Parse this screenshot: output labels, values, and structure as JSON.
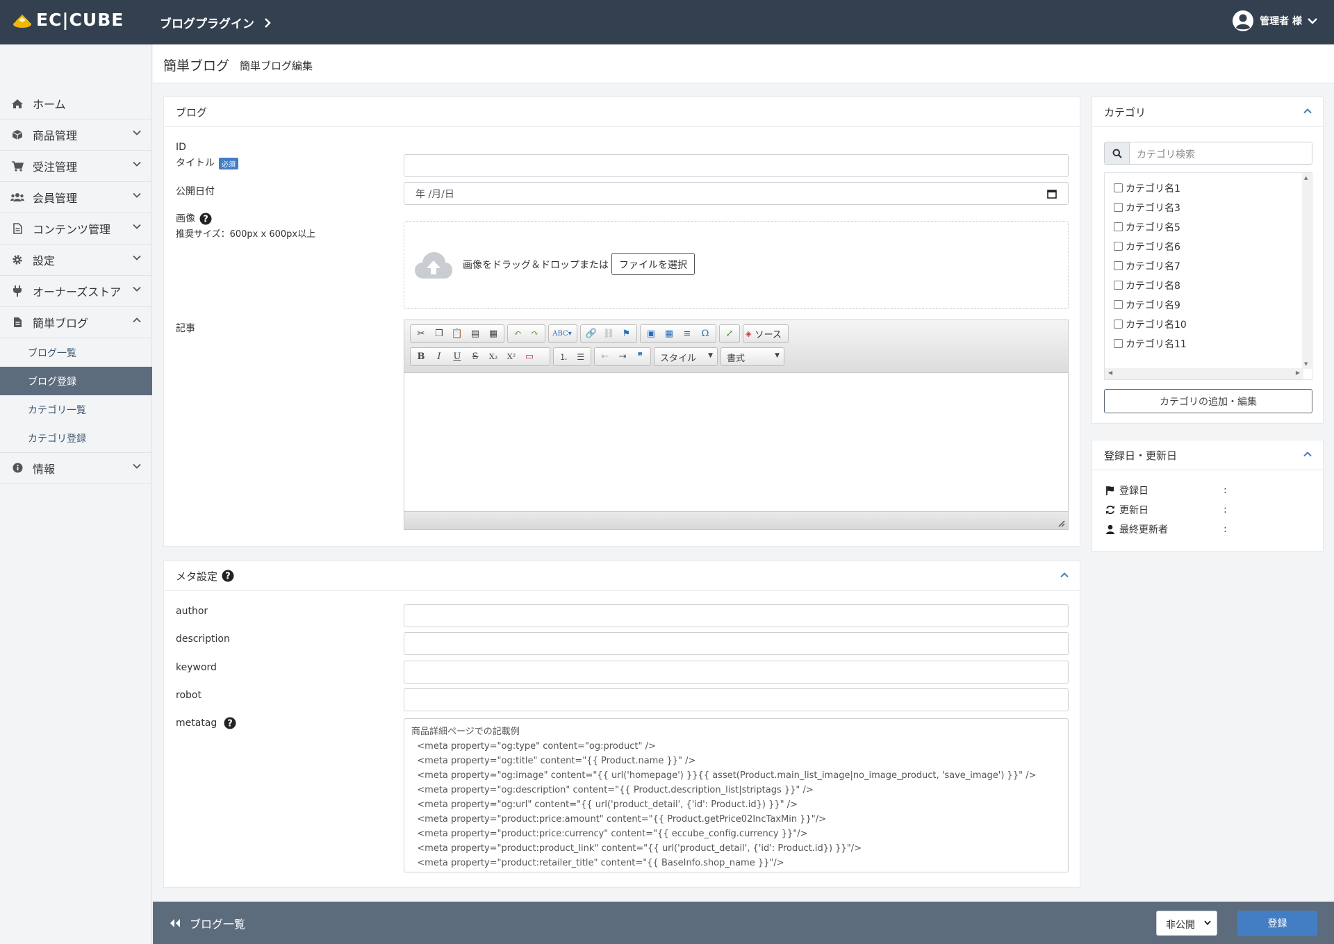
{
  "header": {
    "logo_text": "EC|CUBE",
    "plugin_title": "ブログプラグイン",
    "user_label": "管理者 様"
  },
  "sidebar": {
    "items": [
      {
        "label": "ホーム",
        "icon": "home-icon"
      },
      {
        "label": "商品管理",
        "icon": "cube-icon"
      },
      {
        "label": "受注管理",
        "icon": "cart-icon"
      },
      {
        "label": "会員管理",
        "icon": "users-icon"
      },
      {
        "label": "コンテンツ管理",
        "icon": "file-icon"
      },
      {
        "label": "設定",
        "icon": "gear-icon"
      },
      {
        "label": "オーナーズストア",
        "icon": "plug-icon"
      },
      {
        "label": "簡単ブログ",
        "icon": "file-text-icon"
      },
      {
        "label": "情報",
        "icon": "info-icon"
      }
    ],
    "sub_items": [
      "ブログ一覧",
      "ブログ登録",
      "カテゴリ一覧",
      "カテゴリ登録"
    ],
    "active_sub": "ブログ登録"
  },
  "page": {
    "title": "簡単ブログ",
    "subtitle": "簡単ブログ編集"
  },
  "blog_card": {
    "header": "ブログ",
    "id_label": "ID",
    "title_label": "タイトル",
    "required_badge": "必須",
    "date_label": "公開日付",
    "date_placeholder": "年 /月/日",
    "image_label": "画像",
    "image_hint": "推奨サイズ：600px x 600px以上",
    "dropzone_text": "画像をドラッグ＆ドロップまたは",
    "file_button": "ファイルを選択",
    "article_label": "記事",
    "source_button": "ソース",
    "style_combo": "スタイル",
    "format_combo": "書式"
  },
  "meta_card": {
    "header": "メタ設定",
    "author_label": "author",
    "description_label": "description",
    "keyword_label": "keyword",
    "robot_label": "robot",
    "metatag_label": "metatag",
    "metatag_placeholder": "商品詳細ページでの記載例\n  <meta property=\"og:type\" content=\"og:product\" />\n  <meta property=\"og:title\" content=\"{{ Product.name }}\" />\n  <meta property=\"og:image\" content=\"{{ url('homepage') }}{{ asset(Product.main_list_image|no_image_product, 'save_image') }}\" />\n  <meta property=\"og:description\" content=\"{{ Product.description_list|striptags }}\" />\n  <meta property=\"og:url\" content=\"{{ url('product_detail', {'id': Product.id}) }}\" />\n  <meta property=\"product:price:amount\" content=\"{{ Product.getPrice02IncTaxMin }}\"/>\n  <meta property=\"product:price:currency\" content=\"{{ eccube_config.currency }}\"/>\n  <meta property=\"product:product_link\" content=\"{{ url('product_detail', {'id': Product.id}) }}\"/>\n  <meta property=\"product:retailer_title\" content=\"{{ BaseInfo.shop_name }}\"/>"
  },
  "category_card": {
    "header": "カテゴリ",
    "search_placeholder": "カテゴリ検索",
    "categories": [
      "カテゴリ名1",
      "カテゴリ名3",
      "カテゴリ名5",
      "カテゴリ名6",
      "カテゴリ名7",
      "カテゴリ名8",
      "カテゴリ名9",
      "カテゴリ名10",
      "カテゴリ名11"
    ],
    "edit_button": "カテゴリの追加・編集"
  },
  "dates_card": {
    "header": "登録日・更新日",
    "rows": [
      {
        "label": "登録日",
        "icon": "flag-icon",
        "value": ":"
      },
      {
        "label": "更新日",
        "icon": "refresh-icon",
        "value": ":"
      },
      {
        "label": "最終更新者",
        "icon": "user-icon",
        "value": ":"
      }
    ]
  },
  "footer": {
    "back_label": "ブログ一覧",
    "visibility_value": "非公開",
    "submit_label": "登録"
  },
  "colors": {
    "header_bg": "#33404f",
    "footer_bg": "#5d6c7d",
    "primary": "#437ec4",
    "logo_accent": "#f2b705"
  }
}
